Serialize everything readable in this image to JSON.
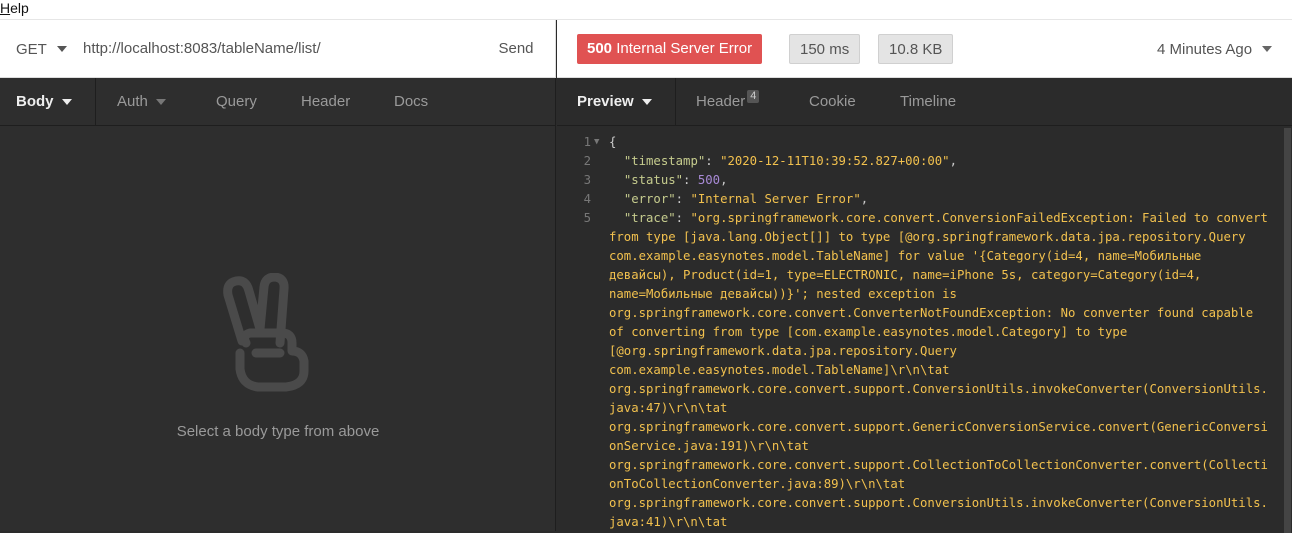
{
  "menu": {
    "help_first": "H",
    "help_rest": "elp"
  },
  "request": {
    "method": "GET",
    "url": "http://localhost:8083/tableName/list/",
    "send_label": "Send"
  },
  "response_meta": {
    "status_code": "500",
    "status_text": "Internal Server Error",
    "time": "150 ms",
    "size": "10.8 KB",
    "ago": "4 Minutes Ago"
  },
  "left_tabs": [
    "Body",
    "Auth",
    "Query",
    "Header",
    "Docs"
  ],
  "left_empty_text": "Select a body type from above",
  "right_tabs": {
    "preview": "Preview",
    "header": "Header",
    "header_count": "4",
    "cookie": "Cookie",
    "timeline": "Timeline"
  },
  "code": {
    "line_numbers": [
      "1",
      "2",
      "3",
      "4",
      "5"
    ],
    "open_brace": "{",
    "timestamp_key": "\"timestamp\"",
    "timestamp_val": "\"2020-12-11T10:39:52.827+00:00\"",
    "status_key": "\"status\"",
    "status_val": "500",
    "error_key": "\"error\"",
    "error_val": "\"Internal Server Error\"",
    "trace_key": "\"trace\"",
    "trace_lines": [
      "\"org.springframework.core.convert.ConversionFailedException: Failed to convert",
      "from type [java.lang.Object[]] to type [@org.springframework.data.jpa.repository.Query",
      "com.example.easynotes.model.TableName] for value '{Category(id=4, name=Мобильные",
      "девайсы), Product(id=1, type=ELECTRONIC, name=iPhone 5s, category=Category(id=4,",
      "name=Мобильные девайсы))}'; nested exception is",
      "org.springframework.core.convert.ConverterNotFoundException: No converter found capable",
      "of converting from type [com.example.easynotes.model.Category] to type",
      "[@org.springframework.data.jpa.repository.Query",
      "com.example.easynotes.model.TableName]\\r\\n\\tat",
      "org.springframework.core.convert.support.ConversionUtils.invokeConverter(ConversionUtils.",
      "java:47)\\r\\n\\tat",
      "org.springframework.core.convert.support.GenericConversionService.convert(GenericConversi",
      "onService.java:191)\\r\\n\\tat",
      "org.springframework.core.convert.support.CollectionToCollectionConverter.convert(Collecti",
      "onToCollectionConverter.java:89)\\r\\n\\tat",
      "org.springframework.core.convert.support.ConversionUtils.invokeConverter(ConversionUtils.",
      "java:41)\\r\\n\\tat"
    ]
  },
  "colors": {
    "error_badge": "#e05252",
    "json_key": "#c6cc8e",
    "json_string": "#f2c14e",
    "json_number": "#a88ad6"
  }
}
